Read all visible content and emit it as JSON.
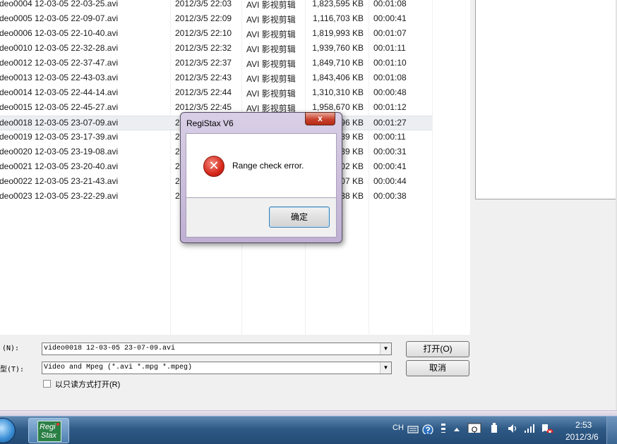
{
  "file_list": {
    "rows": [
      {
        "name": "deo0004 12-03-05 22-03-25.avi",
        "date": "2012/3/5 22:03",
        "type": "AVI 影视剪辑",
        "size": "1,823,595 KB",
        "duration": "00:01:08"
      },
      {
        "name": "deo0005 12-03-05 22-09-07.avi",
        "date": "2012/3/5 22:09",
        "type": "AVI 影视剪辑",
        "size": "1,116,703 KB",
        "duration": "00:00:41"
      },
      {
        "name": "deo0006 12-03-05 22-10-40.avi",
        "date": "2012/3/5 22:10",
        "type": "AVI 影视剪辑",
        "size": "1,819,993 KB",
        "duration": "00:01:07"
      },
      {
        "name": "deo0010 12-03-05 22-32-28.avi",
        "date": "2012/3/5 22:32",
        "type": "AVI 影视剪辑",
        "size": "1,939,760 KB",
        "duration": "00:01:11"
      },
      {
        "name": "deo0012 12-03-05 22-37-47.avi",
        "date": "2012/3/5 22:37",
        "type": "AVI 影视剪辑",
        "size": "1,849,710 KB",
        "duration": "00:01:10"
      },
      {
        "name": "deo0013 12-03-05 22-43-03.avi",
        "date": "2012/3/5 22:43",
        "type": "AVI 影视剪辑",
        "size": "1,843,406 KB",
        "duration": "00:01:08"
      },
      {
        "name": "deo0014 12-03-05 22-44-14.avi",
        "date": "2012/3/5 22:44",
        "type": "AVI 影视剪辑",
        "size": "1,310,310 KB",
        "duration": "00:00:48"
      },
      {
        "name": "deo0015 12-03-05 22-45-27.avi",
        "date": "2012/3/5 22:45",
        "type": "AVI 影视剪辑",
        "size": "1,958,670 KB",
        "duration": "00:01:12"
      },
      {
        "name": "deo0018 12-03-05 23-07-09.avi",
        "date": "2",
        "type": "",
        "size": "96 KB",
        "duration": "00:01:27",
        "selected": true
      },
      {
        "name": "deo0019 12-03-05 23-17-39.avi",
        "date": "2",
        "type": "",
        "size": "89 KB",
        "duration": "00:00:11"
      },
      {
        "name": "deo0020 12-03-05 23-19-08.avi",
        "date": "2",
        "type": "",
        "size": "39 KB",
        "duration": "00:00:31"
      },
      {
        "name": "deo0021 12-03-05 23-20-40.avi",
        "date": "2",
        "type": "",
        "size": "02 KB",
        "duration": "00:00:41"
      },
      {
        "name": "deo0022 12-03-05 23-21-43.avi",
        "date": "2",
        "type": "",
        "size": "07 KB",
        "duration": "00:00:44"
      },
      {
        "name": "deo0023 12-03-05 23-22-29.avi",
        "date": "2",
        "type": "",
        "size": "38 KB",
        "duration": "00:00:38"
      }
    ]
  },
  "form": {
    "filename_label": "(N):",
    "filename_value": "video0018 12-03-05 23-07-09.avi",
    "filetype_label": "型(T):",
    "filetype_value": "Video and Mpeg (*.avi *.mpg *.mpeg)",
    "open_button": "打开(O)",
    "cancel_button": "取消",
    "readonly_label": "以只读方式打开(R)"
  },
  "dialog": {
    "title": "RegiStax V6",
    "close_glyph": "x",
    "message": "Range check error.",
    "ok_button": "确定",
    "error_glyph": "✕"
  },
  "taskbar": {
    "app_icon_line1": "Regi",
    "app_icon_line2": "Stax",
    "language": "CH",
    "time": "2:53",
    "date": "2012/3/6"
  }
}
